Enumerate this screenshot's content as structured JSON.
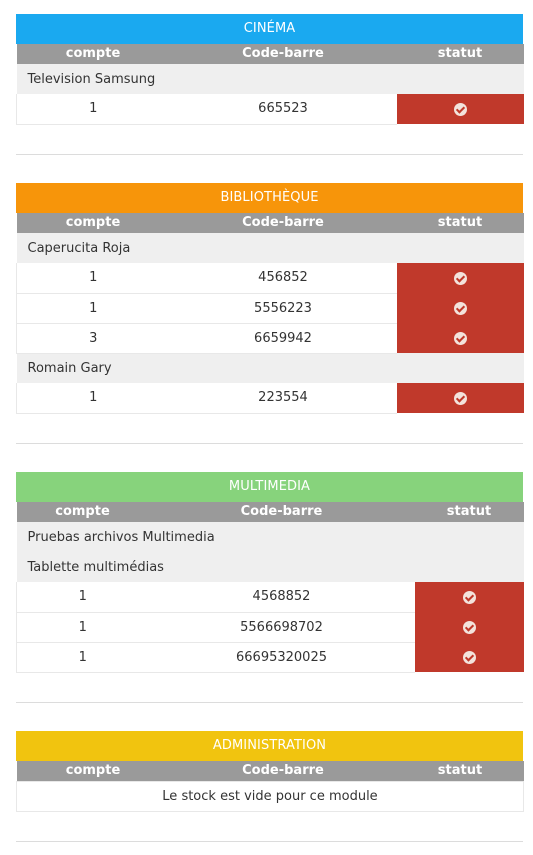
{
  "columns": {
    "count": "compte",
    "barcode": "Code-barre",
    "status": "statut"
  },
  "modules": [
    {
      "title": "CINÉMA",
      "color": "#1aa9f0",
      "groups": [
        {
          "name": "Television Samsung",
          "items": [
            {
              "count": "1",
              "barcode": "665523"
            }
          ]
        }
      ]
    },
    {
      "title": "BIBLIOTHÈQUE",
      "color": "#f7950a",
      "groups": [
        {
          "name": "Caperucita Roja",
          "items": [
            {
              "count": "1",
              "barcode": "456852"
            },
            {
              "count": "1",
              "barcode": "5556223"
            },
            {
              "count": "3",
              "barcode": "6659942"
            }
          ]
        },
        {
          "name": "Romain Gary",
          "items": [
            {
              "count": "1",
              "barcode": "223554"
            }
          ]
        }
      ]
    },
    {
      "title": "MULTIMEDIA",
      "color": "#87d37c",
      "groups": [
        {
          "name": "Pruebas archivos Multimedia",
          "items": []
        },
        {
          "name": "Tablette multimédias",
          "items": [
            {
              "count": "1",
              "barcode": "4568852"
            },
            {
              "count": "1",
              "barcode": "5566698702"
            },
            {
              "count": "1",
              "barcode": "66695320025"
            }
          ]
        }
      ]
    },
    {
      "title": "ADMINISTRATION",
      "color": "#f1c40f",
      "empty_message": "Le stock est vide pour ce module"
    }
  ],
  "status_color": "#c0392b",
  "status_icon": "check-circle-icon"
}
